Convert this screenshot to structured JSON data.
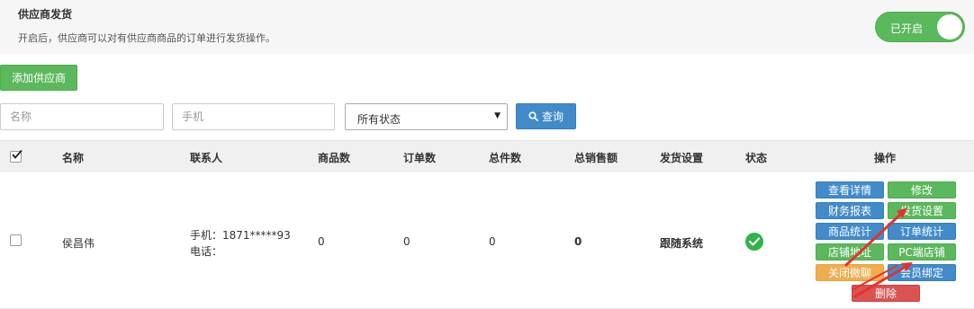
{
  "header": {
    "title": "供应商发货",
    "description": "开启后，供应商可以对有供应商商品的订单进行发货操作。",
    "toggle_label": "已开启"
  },
  "toolbar": {
    "add_label": "添加供应商",
    "name_placeholder": "名称",
    "phone_placeholder": "手机",
    "status_value": "所有状态",
    "search_label": "查询"
  },
  "table": {
    "columns": [
      "名称",
      "联系人",
      "商品数",
      "订单数",
      "总件数",
      "总销售额",
      "发货设置",
      "状态",
      "操作"
    ],
    "rows": [
      {
        "name": "侯昌伟",
        "contact_phone": "手机：1871*****93",
        "contact_tel": "电话：",
        "products": "0",
        "orders": "0",
        "items": "0",
        "sales": "0",
        "shipping": "跟随系统"
      }
    ]
  },
  "actions": {
    "view_details": "查看详情",
    "edit": "修改",
    "finance": "财务报表",
    "ship_settings": "发货设置",
    "product_stats": "商品统计",
    "order_stats": "订单统计",
    "store_address": "店铺地址",
    "pc_store": "PC端店铺",
    "close_chat": "关闭微聊",
    "bind_member": "会员绑定",
    "delete": "删除"
  },
  "colors": {
    "primary": "#428bca",
    "success": "#5cb85c",
    "warning": "#f0ad4e",
    "danger": "#d9534f",
    "annotation": "#e5322d"
  }
}
